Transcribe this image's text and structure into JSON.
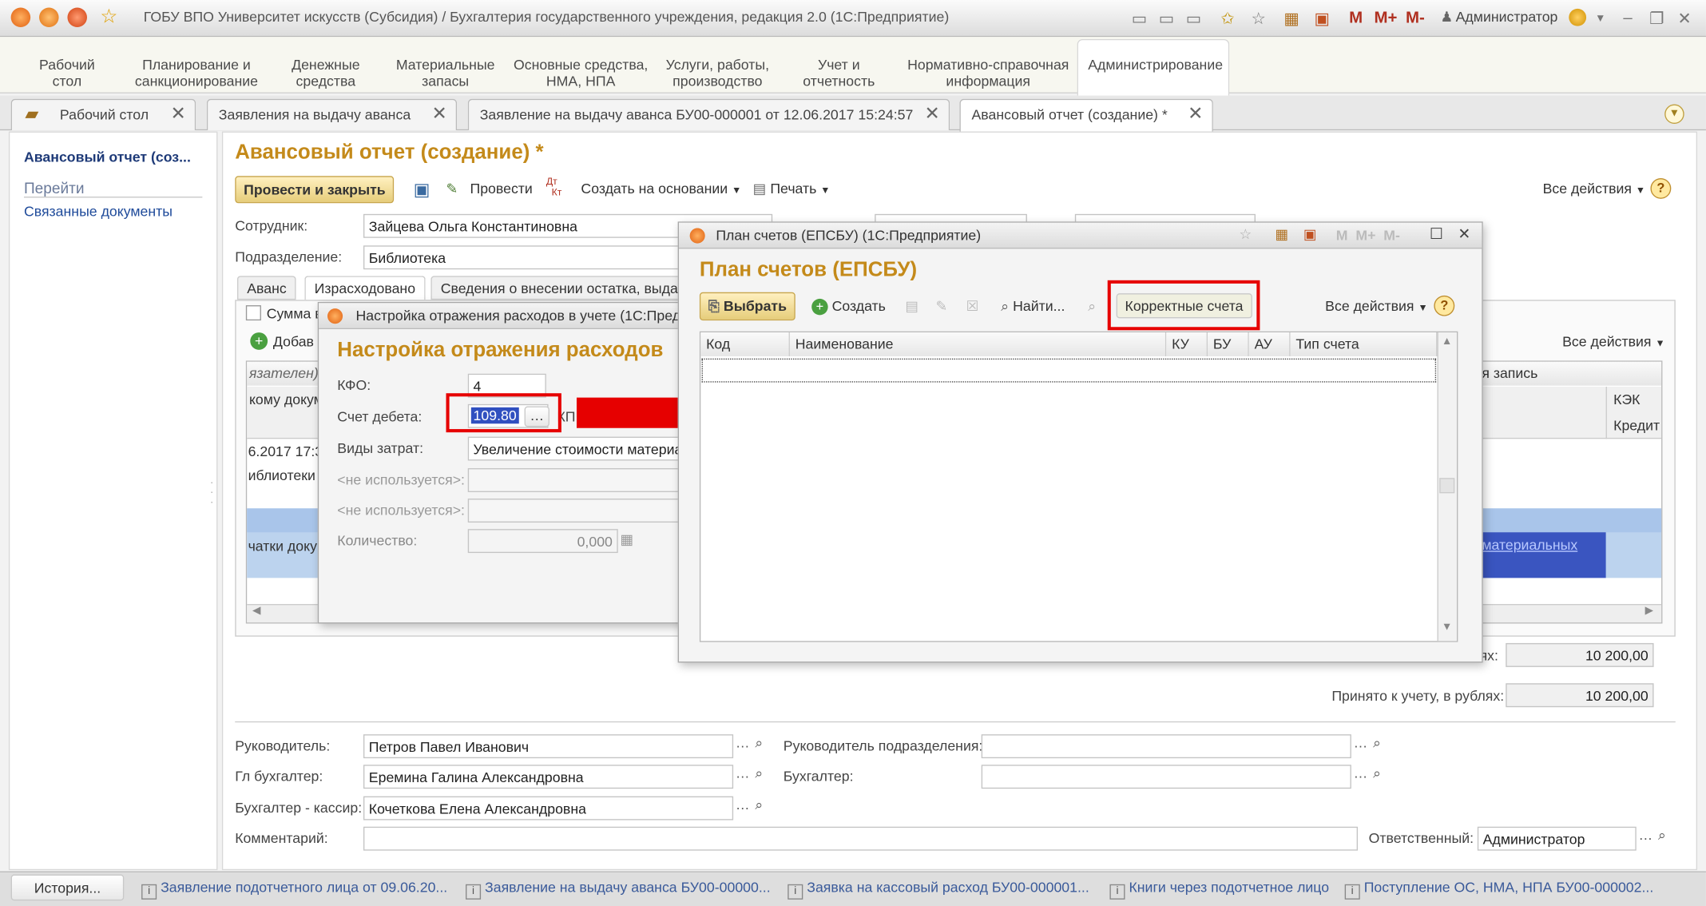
{
  "window": {
    "title": "ГОБУ ВПО Университет искусств (Субсидия) / Бухгалтерия государственного учреждения, редакция 2.0  (1С:Предприятие)",
    "m": "M",
    "mplus": "M+",
    "mminus": "M-",
    "user": "Администратор"
  },
  "sections": [
    "Рабочий\nстол",
    "Планирование и\nсанкционирование",
    "Денежные\nсредства",
    "Материальные\nзапасы",
    "Основные средства,\nНМА, НПА",
    "Услуги, работы,\nпроизводство",
    "Учет и\nотчетность",
    "Нормативно-справочная\nинформация",
    "Администрирование"
  ],
  "tabs": [
    "Рабочий стол",
    "Заявления на выдачу аванса",
    "Заявление на выдачу аванса БУ00-000001 от 12.06.2017 15:24:57",
    "Авансовый отчет (создание) *"
  ],
  "sidebar": {
    "title": "Авансовый отчет (соз...",
    "goto": "Перейти",
    "related": "Связанные документы"
  },
  "doc": {
    "title": "Авансовый отчет (создание) *",
    "post_close": "Провести и закрыть",
    "post": "Провести",
    "create_based": "Создать на основании",
    "print": "Печать",
    "all_actions": "Все действия",
    "help": "?",
    "employee_label": "Сотрудник:",
    "employee": "Зайцева Ольга Константиновна",
    "dept_label": "Подразделение:",
    "dept": "Библиотека",
    "subtabs": [
      "Аванс",
      "Израсходовано",
      "Сведения о внесении остатка, выдаче перерасхода"
    ],
    "sum_label": "Сумма в",
    "add": "Добав",
    "all_actions2": "Все действия",
    "grid_frag": {
      "c1": "язателен)",
      "c2": "кому докум",
      "c3": "6.2017 17:3",
      "c4": "иблиотеки",
      "c5": "чатки доку",
      "entry": "я запись",
      "kek": "КЭК",
      "credit": "Кредит",
      "link": "материальных"
    },
    "total_label": "ях:",
    "total": "10 200,00",
    "accepted_label": "Принято к учету, в рублях:",
    "accepted": "10 200,00",
    "head_label": "Руководитель:",
    "head": "Петров Павел Иванович",
    "dept_head_label": "Руководитель подразделения:",
    "dept_head": "",
    "chief_acc_label": "Гл бухгалтер:",
    "chief_acc": "Еремина Галина Александровна",
    "acc_label": "Бухгалтер:",
    "acc": "",
    "cashier_label": "Бухгалтер - кассир:",
    "cashier": "Кочеткова Елена Александровна",
    "comment_label": "Комментарий:",
    "comment": "",
    "resp_label": "Ответственный:",
    "resp": "Администратор"
  },
  "setup": {
    "wtitle": "Настройка отражения расходов в учете  (1С:Предпр",
    "title": "Настройка отражения расходов",
    "kfo_label": "КФО:",
    "kfo": "4",
    "debit_label": "Счет дебета:",
    "debit": "109.80",
    "kps": "КП",
    "cost_label": "Виды затрат:",
    "cost": "Увеличение стоимости материа",
    "unused": "<не используется>:",
    "qty_label": "Количество:",
    "qty": "0,000"
  },
  "plan": {
    "wtitle": "План счетов (ЕПСБУ)  (1С:Предприятие)",
    "title": "План счетов (ЕПСБУ)",
    "select": "Выбрать",
    "create": "Создать",
    "find": "Найти...",
    "correct": "Корректные счета",
    "all_actions": "Все действия",
    "help": "?",
    "cols": [
      "Код",
      "Наименование",
      "КУ",
      "БУ",
      "АУ",
      "Тип счета"
    ]
  },
  "status": {
    "history": "История...",
    "items": [
      "Заявление подотчетного лица от 09.06.20...",
      "Заявление на выдачу аванса БУ00-00000...",
      "Заявка на кассовый расход БУ00-000001...",
      "Книги через подотчетное лицо",
      "Поступление ОС, НМА, НПА БУ00-000002..."
    ]
  },
  "colors": {
    "accent": "#c48a1a",
    "highlight": "#e60000",
    "selection": "#3050c0"
  }
}
